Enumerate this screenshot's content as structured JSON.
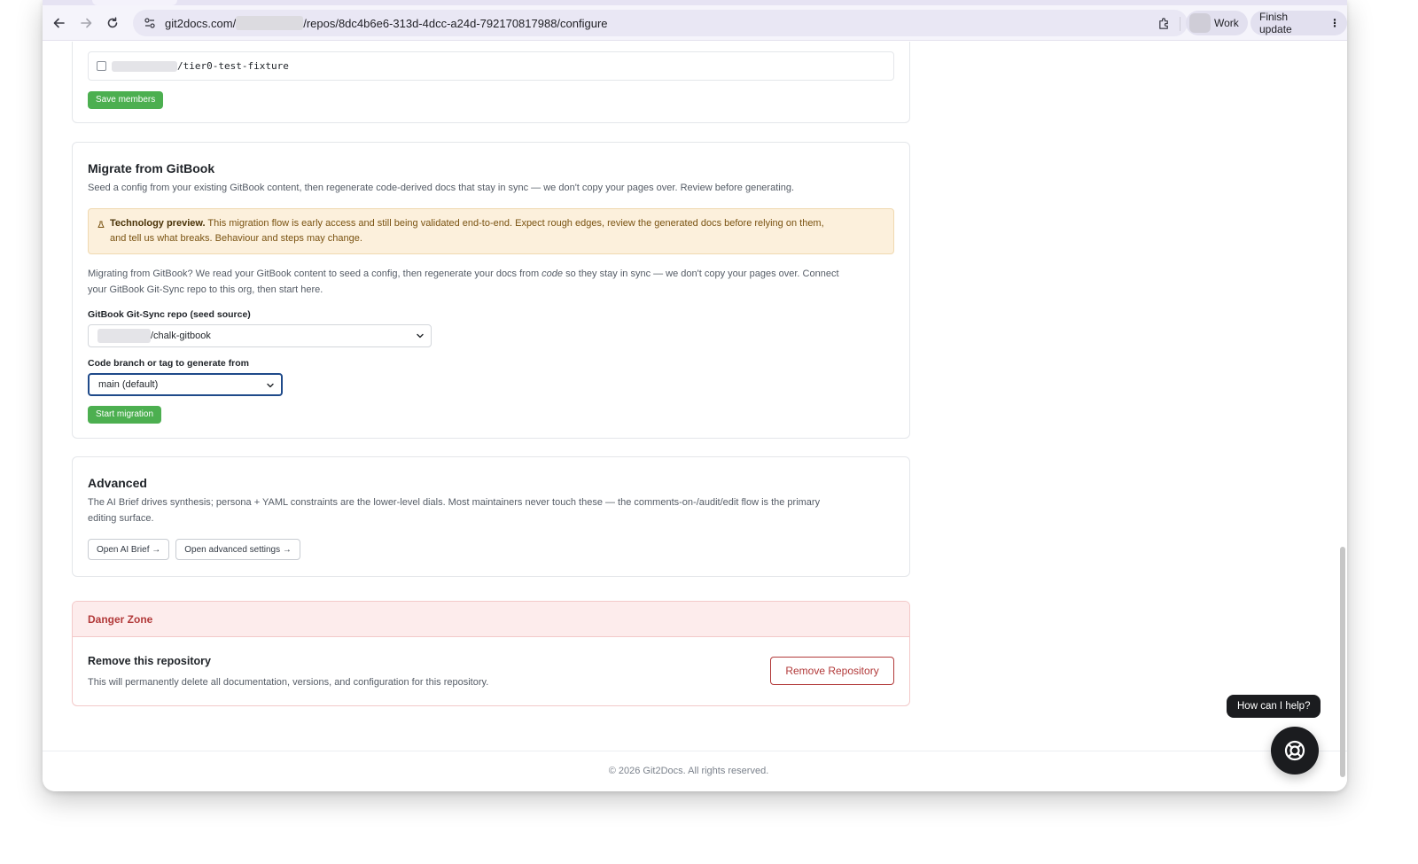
{
  "browser": {
    "url_prefix": "git2docs.com/",
    "url_suffix": "/repos/8dc4b6e6-313d-4dcc-a24d-792170817988/configure",
    "profile_label": "Work",
    "update_label": "Finish update",
    "update_menu_glyph": "⋮"
  },
  "members": {
    "repo_item": "/tier0-test-fixture",
    "save_label": "Save members"
  },
  "migrate": {
    "title": "Migrate from GitBook",
    "subtitle": "Seed a config from your existing GitBook content, then regenerate code-derived docs that stay in sync — we don't copy your pages over. Review before generating.",
    "notice_strong": "Technology preview.",
    "notice_line1": " This migration flow is early access and still being validated end-to-end. Expect rough edges, review the generated docs before relying on them,",
    "notice_line2": "and tell us what breaks. Behaviour and steps may change.",
    "intro_a": "Migrating from GitBook? We read your GitBook content to seed a config, then regenerate your docs from ",
    "intro_code": "code",
    "intro_b": " so they stay in sync — we don't copy your pages over. Connect",
    "intro_line2": "your GitBook Git-Sync repo to this org, then start here.",
    "repo_label": "GitBook Git-Sync repo (seed source)",
    "repo_value": "/chalk-gitbook",
    "branch_label": "Code branch or tag to generate from",
    "branch_value": "main (default)",
    "start_label": "Start migration"
  },
  "advanced": {
    "title": "Advanced",
    "description_line1": "The AI Brief drives synthesis; persona + YAML constraints are the lower-level dials. Most maintainers never touch these — the comments-on-/audit/edit flow is the primary",
    "description_line2": "editing surface.",
    "ai_brief_label": "Open AI Brief →",
    "settings_label": "Open advanced settings →"
  },
  "danger": {
    "title": "Danger Zone",
    "heading": "Remove this repository",
    "description": "This will permanently delete all documentation, versions, and configuration for this repository.",
    "button_label": "Remove Repository"
  },
  "footer": {
    "text": "© 2026 Git2Docs. All rights reserved."
  },
  "help": {
    "bubble": "How can I help?"
  },
  "colors": {
    "accent_green": "#4caf50",
    "danger_red": "#b23a3a",
    "notice_bg": "#fcf0dc",
    "focus_blue": "#1f4a8a"
  },
  "icons": {
    "back": "back-arrow-icon",
    "forward": "forward-arrow-icon",
    "reload": "reload-icon",
    "site_info": "tune-icon",
    "bookmark": "star-icon",
    "extensions": "puzzle-icon",
    "notice": "flask-icon",
    "help": "lifebuoy-icon"
  }
}
